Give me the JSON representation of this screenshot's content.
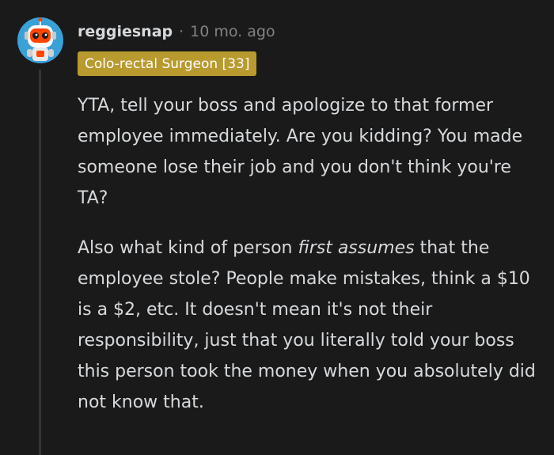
{
  "comment": {
    "username": "reggiesnap",
    "separator": "·",
    "timestamp": "10 mo. ago",
    "flair": "Colo-rectal Surgeon [33]",
    "paragraph1": "YTA, tell your boss and apologize to that former employee immediately. Are you kidding? You made someone lose their job and you don't think you're TA?",
    "paragraph2": {
      "before": "Also what kind of person ",
      "emphasis": "first assumes",
      "after": " that the employee stole? People make mistakes, think a $10 is a $2, etc. It doesn't mean it's not their responsibility, just that you literally told your boss this person took the money when you absolutely did not know that."
    }
  },
  "colors": {
    "background": "#1a1a1b",
    "text": "#d7dadc",
    "muted": "#818384",
    "flair_bg": "#b89a2e",
    "avatar_bg": "#3aa0d8",
    "thread_line": "#343536"
  },
  "icons": {
    "avatar": "robot-snoo-avatar"
  }
}
